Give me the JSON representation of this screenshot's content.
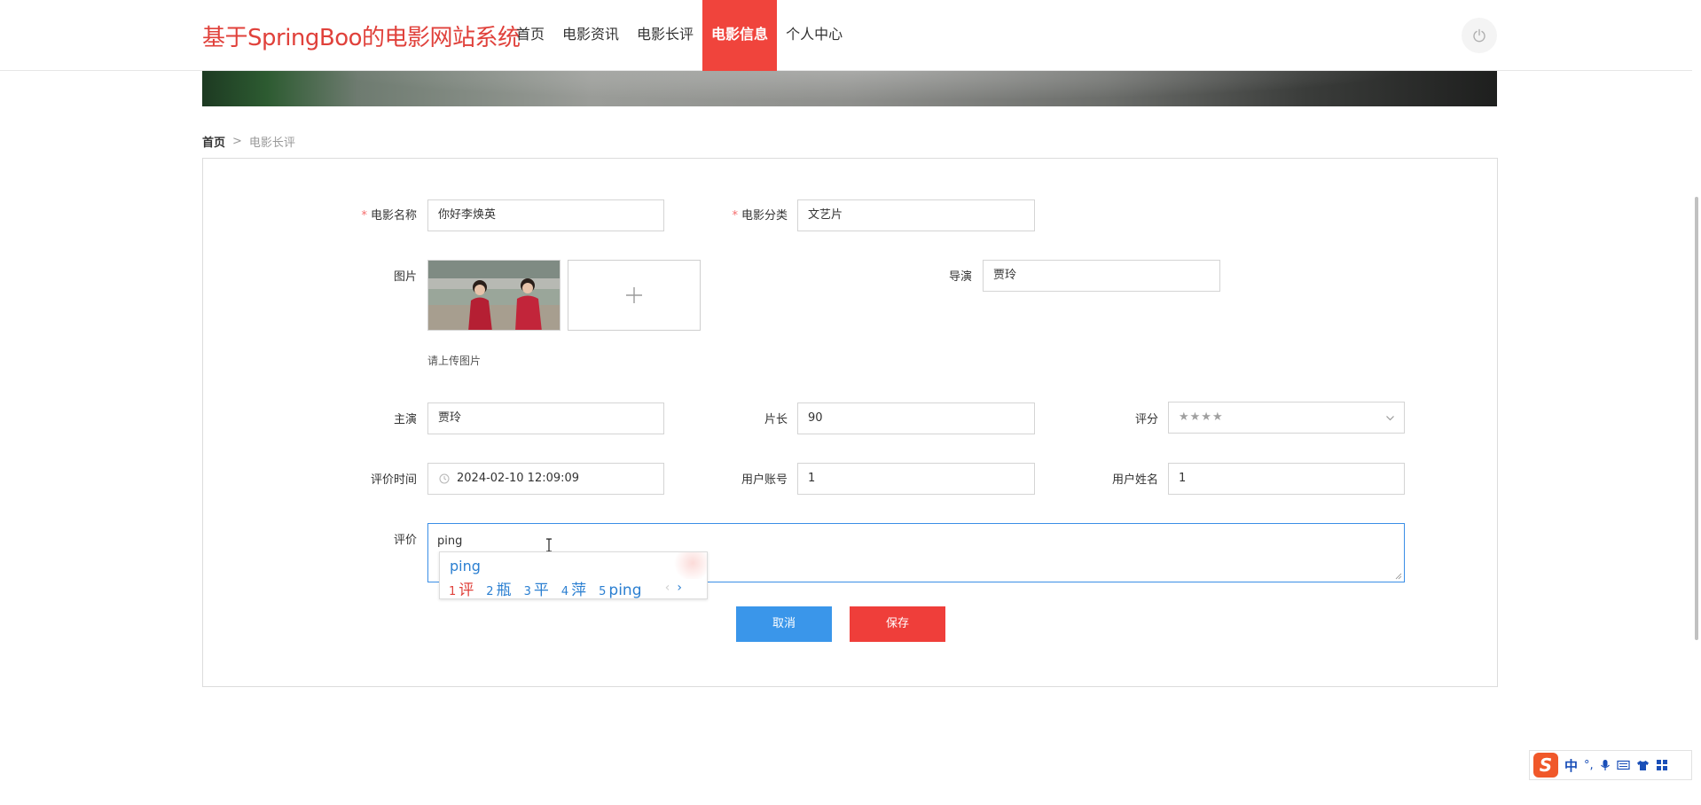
{
  "header": {
    "site_title": "基于SpringBoo的电影网站系统",
    "nav": [
      {
        "label": "首页",
        "active": false
      },
      {
        "label": "电影资讯",
        "active": false
      },
      {
        "label": "电影长评",
        "active": false
      },
      {
        "label": "电影信息",
        "active": true
      },
      {
        "label": "个人中心",
        "active": false
      }
    ],
    "accent_color": "#f0443c"
  },
  "breadcrumb": {
    "home": "首页",
    "separator": ">",
    "current": "电影长评"
  },
  "form": {
    "movie_name": {
      "label": "电影名称",
      "required_mark": "*",
      "value": "你好李焕英"
    },
    "category": {
      "label": "电影分类",
      "required_mark": "*",
      "value": "文艺片"
    },
    "image": {
      "label": "图片",
      "hint": "请上传图片",
      "upload_icon": "plus-icon"
    },
    "director": {
      "label": "导演",
      "value": "贾玲"
    },
    "lead_actor": {
      "label": "主演",
      "value": "贾玲"
    },
    "duration": {
      "label": "片长",
      "value": "90"
    },
    "rating": {
      "label": "评分",
      "value": "★★★★"
    },
    "review_time": {
      "label": "评价时间",
      "value": "2024-02-10 12:09:09"
    },
    "user_account": {
      "label": "用户账号",
      "value": "1"
    },
    "user_name": {
      "label": "用户姓名",
      "value": "1"
    },
    "review": {
      "label": "评价",
      "value": "ping"
    },
    "cancel_label": "取消",
    "save_label": "保存"
  },
  "ime_popup": {
    "composition": "ping",
    "candidates": [
      {
        "num": "1",
        "text": "评"
      },
      {
        "num": "2",
        "text": "瓶"
      },
      {
        "num": "3",
        "text": "平"
      },
      {
        "num": "4",
        "text": "萍"
      },
      {
        "num": "5",
        "text": "ping"
      }
    ]
  },
  "ime_toolbar": {
    "logo": "S",
    "mode": "中",
    "punct": "°,"
  }
}
